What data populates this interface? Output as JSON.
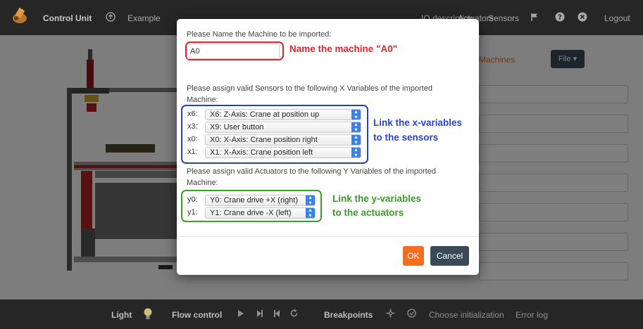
{
  "nav": {
    "brand": "Control Unit",
    "example": "Example",
    "io_description": "IO description",
    "actuators": "Actuators",
    "sensors": "Sensors",
    "logout": "Logout"
  },
  "panel": {
    "machines_tab": "Machines",
    "file_button": "File ▾"
  },
  "bottom": {
    "light": "Light",
    "flow_control": "Flow control",
    "breakpoints": "Breakpoints",
    "choose_init": "Choose initialization",
    "error_log": "Error log"
  },
  "modal": {
    "name_prompt": "Please Name the Machine to be imported:",
    "name_value": "A0",
    "name_annotation": "Name the machine \"A0\"",
    "sensor_prompt_1": "Please assign valid Sensors to the following X Variables of the imported",
    "sensor_prompt_2": "Machine:",
    "x_rows": [
      {
        "var": "x6:",
        "value": "X6: Z-Axis: Crane at position up"
      },
      {
        "var": "x3:",
        "value": "X9: User button"
      },
      {
        "var": "x0:",
        "value": "X0: X-Axis: Crane position right"
      },
      {
        "var": "x1:",
        "value": "X1: X-Axis: Crane position left"
      }
    ],
    "x_annotation_1": "Link the x-variables",
    "x_annotation_2": "to the sensors",
    "actuator_prompt_1": "Please assign valid Actuators to the following Y Variables of the imported",
    "actuator_prompt_2": "Machine:",
    "y_rows": [
      {
        "var": "y0:",
        "value": "Y0: Crane drive +X (right)"
      },
      {
        "var": "y1:",
        "value": "Y1: Crane drive -X (left)"
      }
    ],
    "y_annotation_1": "Link the y-variables",
    "y_annotation_2": "to the actuators",
    "ok": "OK",
    "cancel": "Cancel"
  },
  "colors": {
    "accent": "#f26f21",
    "annotation_red": "#e0262b",
    "annotation_blue": "#2a44cf",
    "annotation_green": "#3d9a2b"
  }
}
